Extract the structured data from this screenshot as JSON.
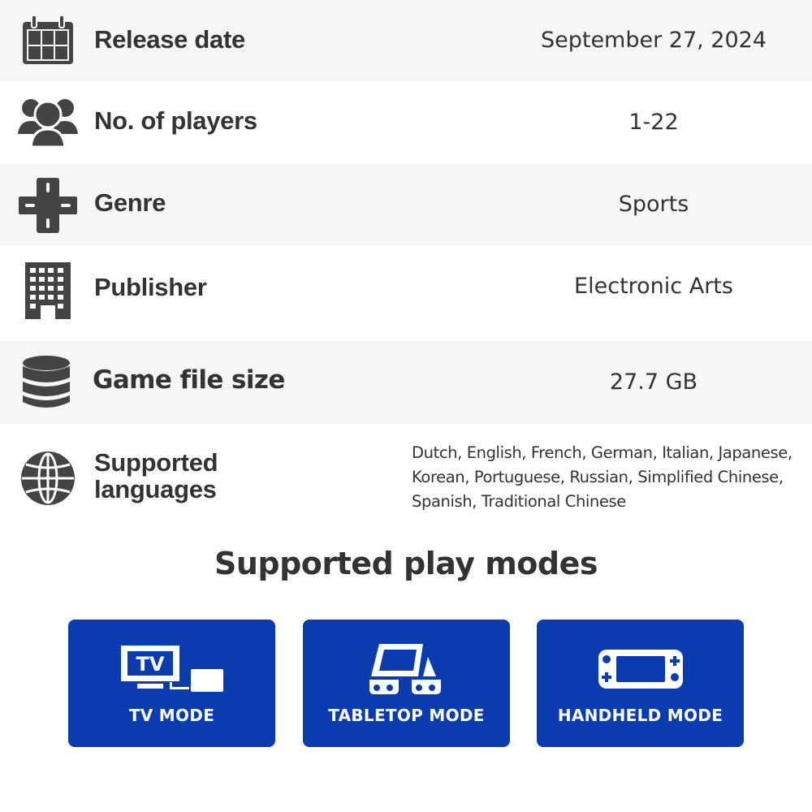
{
  "colors": {
    "row_alt_bg": "#f6f6f6",
    "text": "#333333",
    "mode_card_bg": "#0a3cb0",
    "mode_card_text": "#ffffff"
  },
  "specs": [
    {
      "icon": "calendar-icon",
      "label": "Release date",
      "value": "September 27, 2024"
    },
    {
      "icon": "players-icon",
      "label": "No. of players",
      "value": "1-22"
    },
    {
      "icon": "dpad-icon",
      "label": "Genre",
      "value": "Sports"
    },
    {
      "icon": "building-icon",
      "label": "Publisher",
      "value": "Electronic Arts"
    },
    {
      "icon": "database-icon",
      "label": "Game file size",
      "value": "27.7 GB"
    },
    {
      "icon": "globe-icon",
      "label_line1": "Supported",
      "label_line2": "languages",
      "value": "Dutch, English, French, German, Italian, Japanese, Korean, Portuguese, Russian, Simplified Chinese, Spanish, Traditional Chinese"
    }
  ],
  "play_modes": {
    "title": "Supported play modes",
    "modes": [
      {
        "icon": "tv-icon",
        "icon_text": "TV",
        "label": "TV MODE"
      },
      {
        "icon": "tabletop-icon",
        "label": "TABLETOP MODE"
      },
      {
        "icon": "handheld-icon",
        "label": "HANDHELD MODE"
      }
    ]
  }
}
